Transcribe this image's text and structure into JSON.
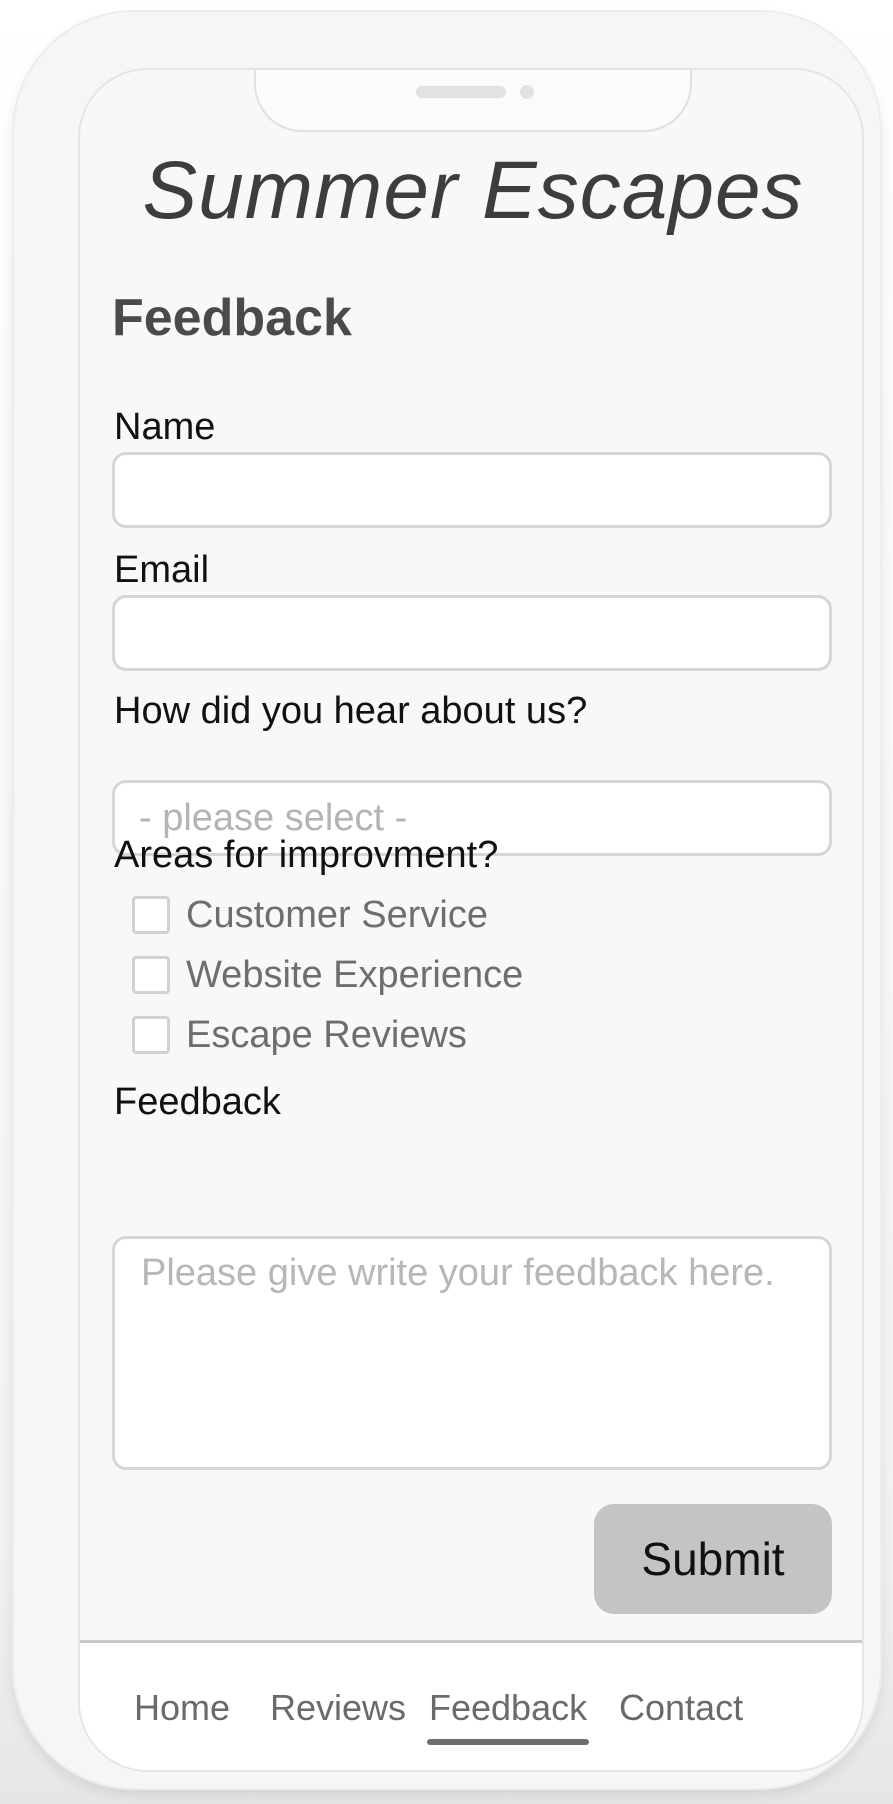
{
  "app": {
    "title": "Summer Escapes"
  },
  "page": {
    "heading": "Feedback"
  },
  "form": {
    "name_label": "Name",
    "name_value": "",
    "email_label": "Email",
    "email_value": "",
    "source_label": "How did you hear about us?",
    "source_selected": "- please select -",
    "areas_label": "Areas for improvment?",
    "areas": [
      {
        "label": "Customer Service",
        "checked": false
      },
      {
        "label": "Website Experience",
        "checked": false
      },
      {
        "label": "Escape Reviews",
        "checked": false
      }
    ],
    "feedback_label": "Feedback",
    "feedback_placeholder": "Please give write your feedback here.",
    "submit_label": "Submit"
  },
  "nav": {
    "items": [
      {
        "label": "Home",
        "active": false
      },
      {
        "label": "Reviews",
        "active": false
      },
      {
        "label": "Feedback",
        "active": true
      },
      {
        "label": "Contact",
        "active": false
      }
    ]
  },
  "colors": {
    "background": "#f7f8f7",
    "submit_button": "#c4c4c4",
    "field_border": "#d6d6d6",
    "placeholder_text": "#b4b4b4"
  }
}
